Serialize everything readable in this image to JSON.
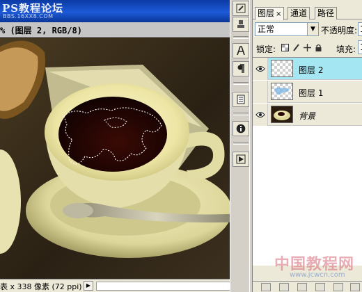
{
  "document": {
    "watermark_title": "PS教程论坛",
    "watermark_subtitle": "BBS.16XX8.COM",
    "info": "% (图层 2, RGB/8)",
    "status": "表 x 338 像素 (72 ppi)",
    "status_arrow": "▶"
  },
  "layers_panel": {
    "tabs": [
      {
        "label": "图层",
        "close": "×"
      },
      {
        "label": "通道"
      },
      {
        "label": "路径"
      }
    ],
    "blend_mode": "正常",
    "opacity_label": "不透明度:",
    "opacity_value": "1",
    "lock_label": "锁定:",
    "fill_label": "填充:",
    "fill_value": "1",
    "layers": [
      {
        "name": "图层 2",
        "visible": true,
        "selected": true
      },
      {
        "name": "图层 1",
        "visible": false,
        "selected": false
      },
      {
        "name": "背景",
        "visible": true,
        "selected": false
      }
    ]
  },
  "site_watermark": {
    "text": "中国教程网",
    "url": "www.jcwcn.com"
  },
  "colors": {
    "selected_layer": "#a5e6f3",
    "title_bar": "#1d5ad8"
  },
  "icons": [
    "eye-icon",
    "paragraph-icon",
    "character-icon",
    "info-icon",
    "play-icon",
    "layer-comps-icon"
  ]
}
